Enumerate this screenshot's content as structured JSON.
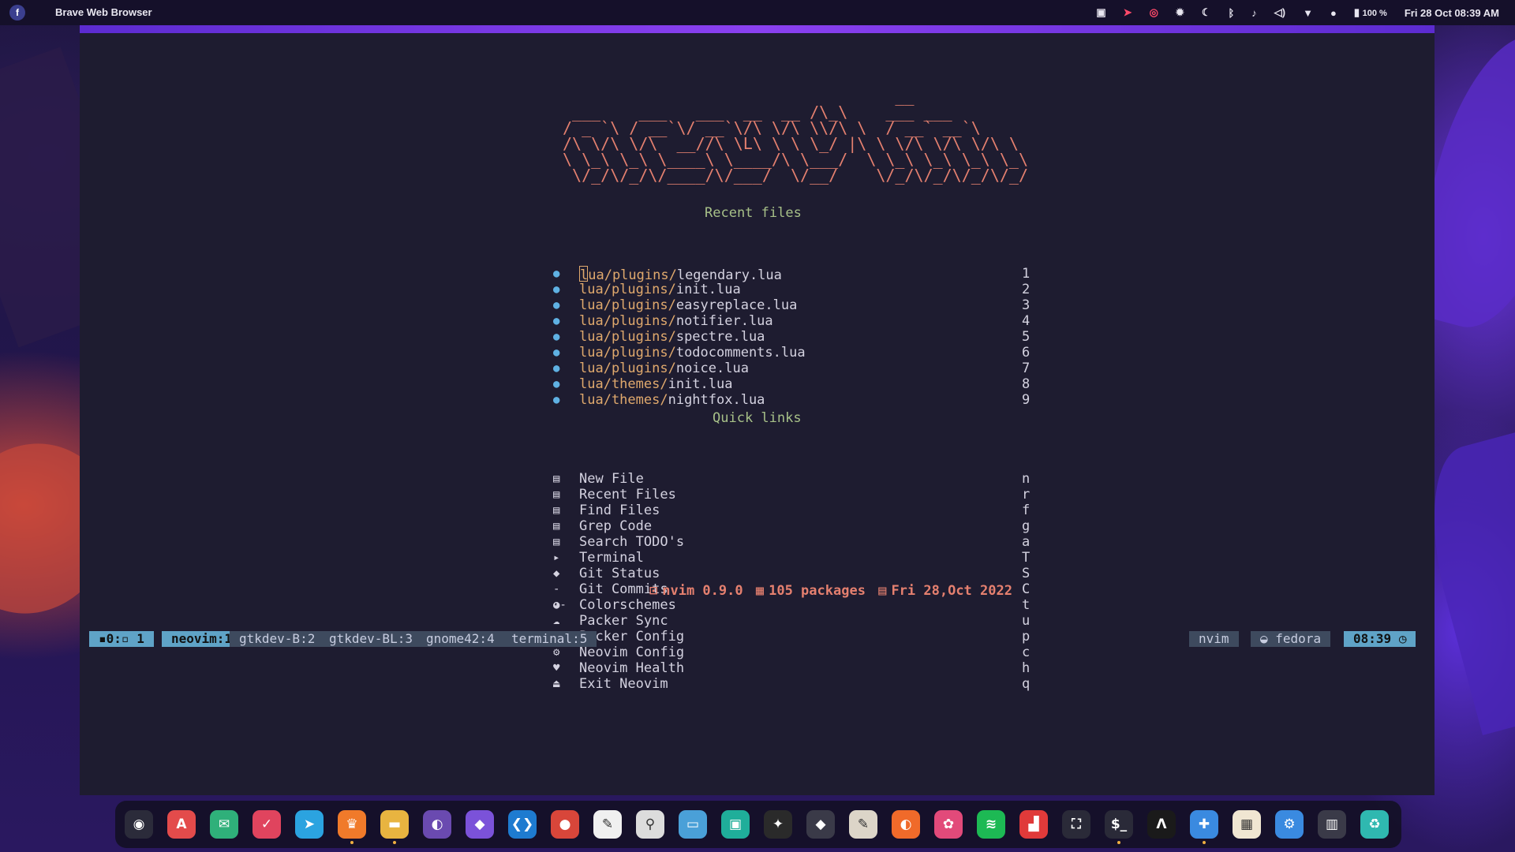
{
  "topbar": {
    "app_title": "Brave Web Browser",
    "battery": "100 %",
    "clock": "Fri 28 Oct 08:39 AM",
    "tray_icons": [
      "screenshot-icon",
      "location-icon",
      "checkmark-icon",
      "settings-icon",
      "night-mode-icon",
      "bluetooth-icon",
      "bell-icon",
      "volume-icon",
      "wifi-icon",
      "user-icon",
      "battery-icon"
    ]
  },
  "dashboard": {
    "header_ascii": "                                   __\n ___    ___   ___  __  __ /\\_\\    ___ ___\n/ _ `\\ / __`\\/ __`\\/\\ \\/\\ \\\\/\\ \\  / __` __`\\\n/\\ \\/\\ \\/\\  __//\\ \\L\\ \\ \\ \\_/ |\\ \\ \\/\\ \\/\\ \\/\\ \\\n\\ \\_\\ \\_\\ \\____\\ \\____/\\ \\___/  \\ \\_\\ \\_\\ \\_\\ \\_\\\n \\/_/\\/_/\\/____/\\/___/  \\/__/    \\/_/\\/_/\\/_/\\/_/",
    "recent_title": "Recent files",
    "recent_files": [
      {
        "dir": "lua/plugins/",
        "name": "legendary.lua",
        "key": "1"
      },
      {
        "dir": "lua/plugins/",
        "name": "init.lua",
        "key": "2"
      },
      {
        "dir": "lua/plugins/",
        "name": "easyreplace.lua",
        "key": "3"
      },
      {
        "dir": "lua/plugins/",
        "name": "notifier.lua",
        "key": "4"
      },
      {
        "dir": "lua/plugins/",
        "name": "spectre.lua",
        "key": "5"
      },
      {
        "dir": "lua/plugins/",
        "name": "todocomments.lua",
        "key": "6"
      },
      {
        "dir": "lua/plugins/",
        "name": "noice.lua",
        "key": "7"
      },
      {
        "dir": "lua/themes/",
        "name": "init.lua",
        "key": "8"
      },
      {
        "dir": "lua/themes/",
        "name": "nightfox.lua",
        "key": "9"
      }
    ],
    "quick_title": "Quick links",
    "quick_links": [
      {
        "label": "New File",
        "key": "n",
        "icon": "file-icon"
      },
      {
        "label": "Recent Files",
        "key": "r",
        "icon": "recent-file-icon"
      },
      {
        "label": "Find Files",
        "key": "f",
        "icon": "find-file-icon"
      },
      {
        "label": "Grep Code",
        "key": "g",
        "icon": "grep-icon"
      },
      {
        "label": "Search TODO's",
        "key": "a",
        "icon": "todo-icon"
      },
      {
        "label": "Terminal",
        "key": "T",
        "icon": "terminal-icon"
      },
      {
        "label": "Git Status",
        "key": "S",
        "icon": "git-icon"
      },
      {
        "label": "Git Commits",
        "key": "C",
        "icon": "git-commit-icon"
      },
      {
        "label": "Colorschemes",
        "key": "t",
        "icon": "palette-icon"
      },
      {
        "label": "Packer Sync",
        "key": "u",
        "icon": "cloud-sync-icon"
      },
      {
        "label": "Packer Config",
        "key": "p",
        "icon": "gear-icon"
      },
      {
        "label": "Neovim Config",
        "key": "c",
        "icon": "gear-icon"
      },
      {
        "label": "Neovim Health",
        "key": "h",
        "icon": "heart-icon"
      },
      {
        "label": "Exit Neovim",
        "key": "q",
        "icon": "exit-icon"
      }
    ],
    "footer": {
      "version": "nvim 0.9.0",
      "packages": "105 packages",
      "date": "Fri 28,Oct 2022"
    }
  },
  "tmux": {
    "session": "0:",
    "pane": "1",
    "windows": [
      "neovim:1",
      "gtkdev-B:2",
      "gtkdev-BL:3",
      "gnome42:4",
      "terminal:5"
    ],
    "right": {
      "program": "nvim",
      "host": "fedora",
      "time": "08:39"
    }
  },
  "dock": {
    "apps": [
      {
        "name": "eye-app",
        "glyph": "◉",
        "color": "#2b2b3a"
      },
      {
        "name": "app-store",
        "glyph": "A",
        "color": "#e34b4b"
      },
      {
        "name": "mail",
        "glyph": "✉",
        "color": "#2fb07a"
      },
      {
        "name": "todoist",
        "glyph": "✓",
        "color": "#e0445e"
      },
      {
        "name": "telegram",
        "glyph": "➤",
        "color": "#2ba3e0"
      },
      {
        "name": "brave",
        "glyph": "♛",
        "color": "#f07a2a"
      },
      {
        "name": "files",
        "glyph": "▬",
        "color": "#e8b440"
      },
      {
        "name": "github",
        "glyph": "◐",
        "color": "#6a4ab0"
      },
      {
        "name": "obsidian",
        "glyph": "◆",
        "color": "#7b52d9"
      },
      {
        "name": "vscode",
        "glyph": "❮❯",
        "color": "#1e7bd0"
      },
      {
        "name": "chrome",
        "glyph": "●",
        "color": "#d8463a"
      },
      {
        "name": "text-editor",
        "glyph": "✎",
        "color": "#f0f0f0"
      },
      {
        "name": "search",
        "glyph": "⚲",
        "color": "#dcdcdc"
      },
      {
        "name": "books",
        "glyph": "▭",
        "color": "#4aa0d8"
      },
      {
        "name": "screenshot-tool",
        "glyph": "▣",
        "color": "#1fae9a"
      },
      {
        "name": "figma",
        "glyph": "✦",
        "color": "#2a2a2a"
      },
      {
        "name": "github-desktop",
        "glyph": "◆",
        "color": "#3a3a48"
      },
      {
        "name": "inkscape",
        "glyph": "✎",
        "color": "#dcd5c8"
      },
      {
        "name": "colorpicker",
        "glyph": "◐",
        "color": "#f06a2a"
      },
      {
        "name": "pinwheel",
        "glyph": "✿",
        "color": "#e24a7a"
      },
      {
        "name": "spotify",
        "glyph": "≋",
        "color": "#1db954"
      },
      {
        "name": "audio-app",
        "glyph": "▟",
        "color": "#e03a3a"
      },
      {
        "name": "screenshot-frame",
        "glyph": "⛶",
        "color": "#2a2a38"
      },
      {
        "name": "terminal",
        "glyph": "$_",
        "color": "#2a2a38"
      },
      {
        "name": "alacritty",
        "glyph": "Λ",
        "color": "#1a1a1a"
      },
      {
        "name": "extensions",
        "glyph": "✚",
        "color": "#3a8ae0"
      },
      {
        "name": "settings-panels",
        "glyph": "▦",
        "color": "#f0e6d2"
      },
      {
        "name": "settings",
        "glyph": "⚙",
        "color": "#3a8ae0"
      },
      {
        "name": "archive",
        "glyph": "▥",
        "color": "#3a3a48"
      },
      {
        "name": "trash",
        "glyph": "♻",
        "color": "#2fb8b0"
      }
    ]
  }
}
